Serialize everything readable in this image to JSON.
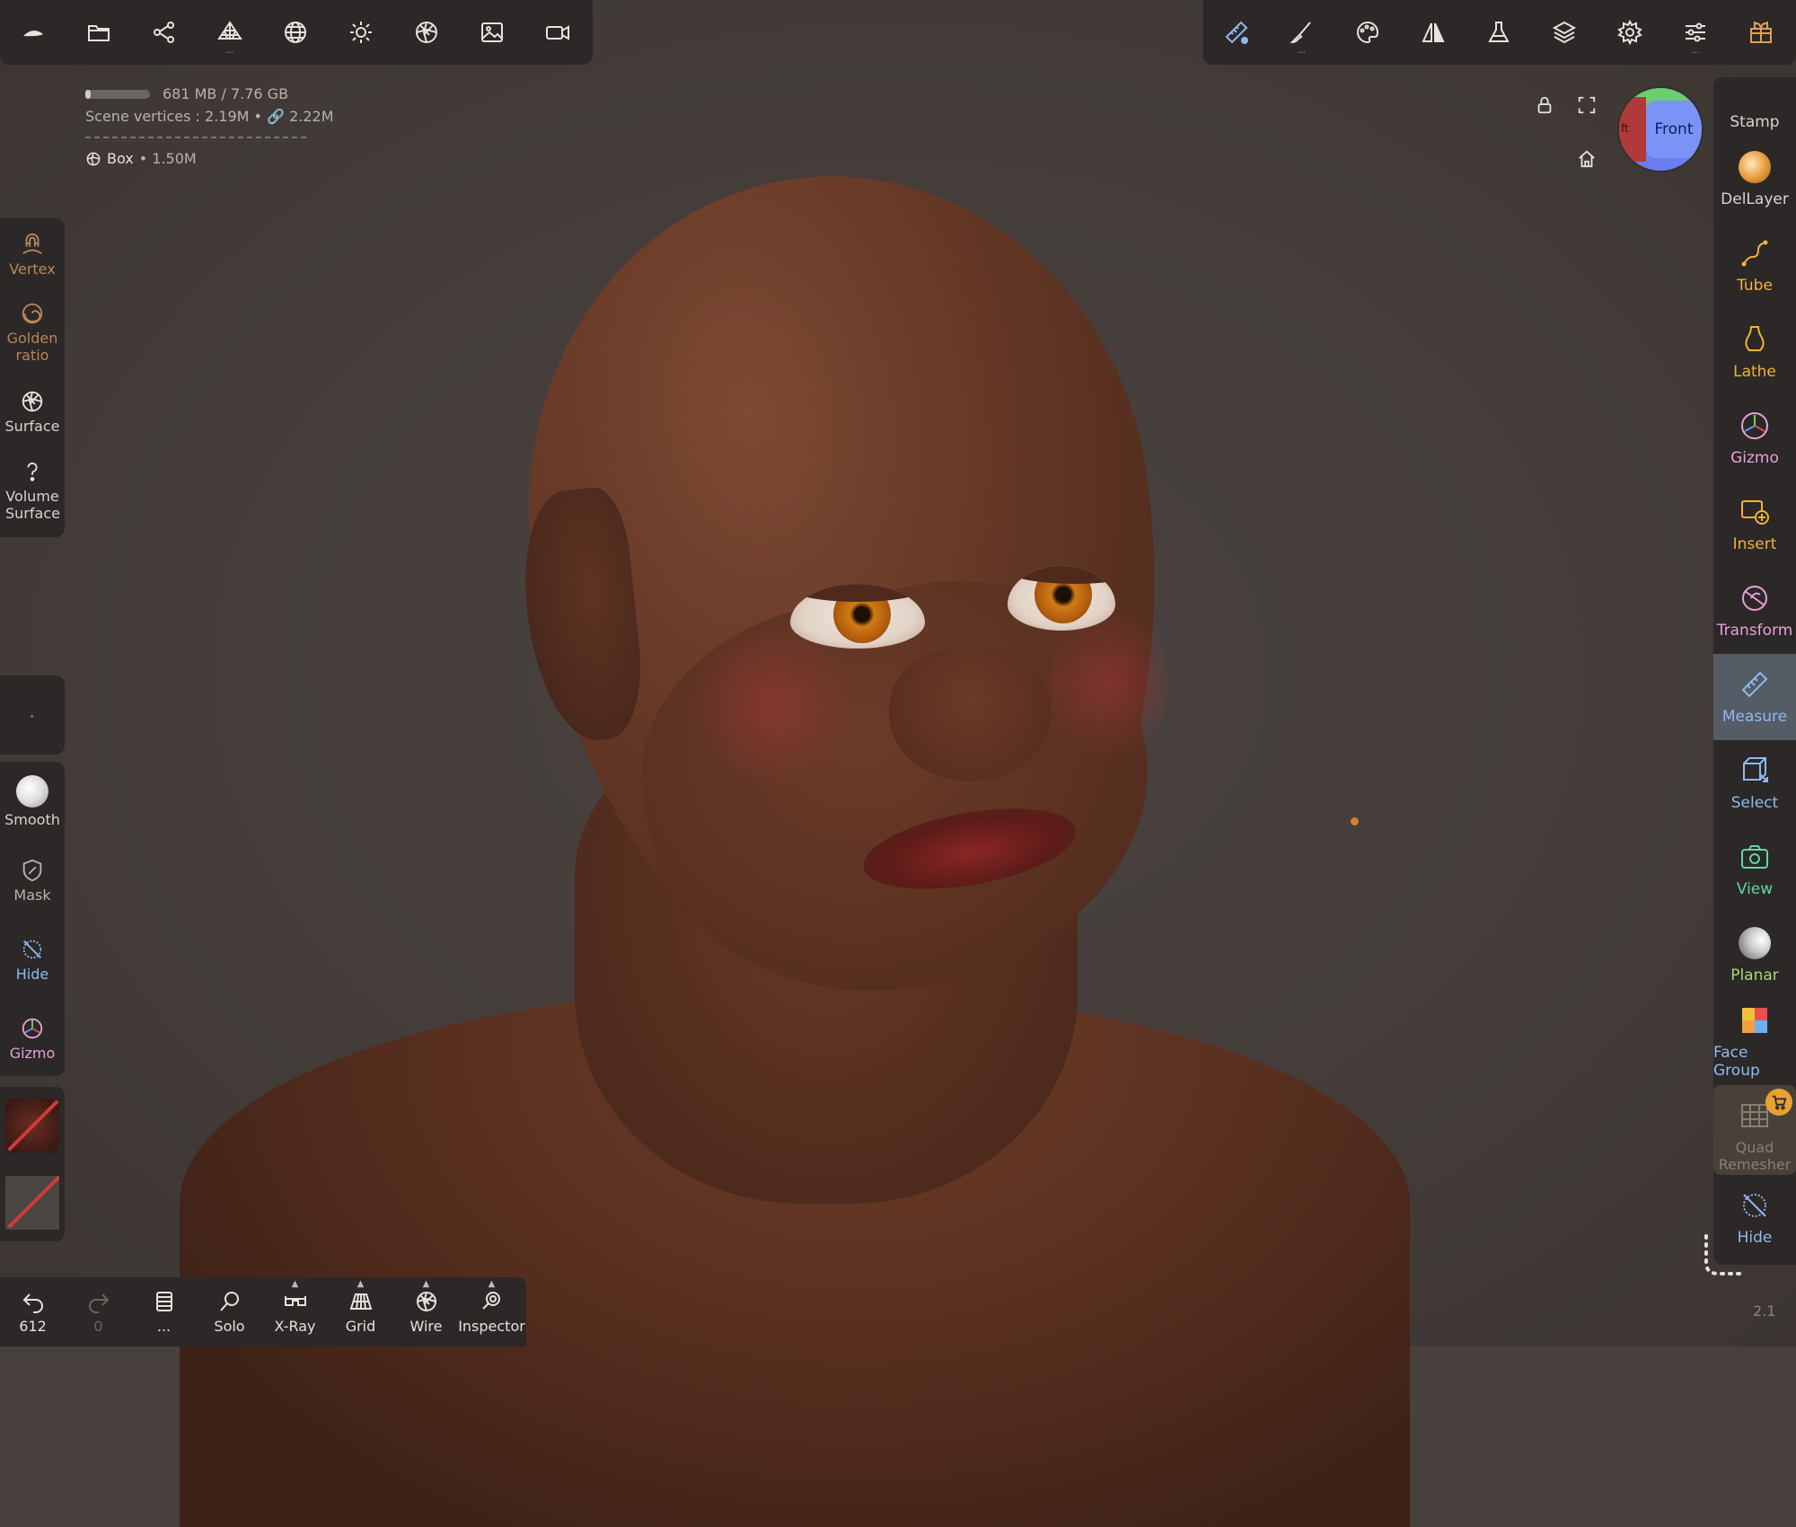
{
  "top_left_toolbar": [
    {
      "name": "nomad-logo-icon"
    },
    {
      "name": "folder-icon"
    },
    {
      "name": "scene-graph-icon"
    },
    {
      "name": "topology-icon",
      "dots": "..."
    },
    {
      "name": "mesh-sphere-icon"
    },
    {
      "name": "light-icon"
    },
    {
      "name": "shading-icon"
    },
    {
      "name": "background-image-icon"
    },
    {
      "name": "camera-icon"
    }
  ],
  "top_right_toolbar": [
    {
      "name": "measure-ruler-icon"
    },
    {
      "name": "brush-icon",
      "dots": "..."
    },
    {
      "name": "palette-icon"
    },
    {
      "name": "symmetry-icon"
    },
    {
      "name": "flask-icon"
    },
    {
      "name": "layers-icon"
    },
    {
      "name": "settings-gear-icon"
    },
    {
      "name": "sliders-icon",
      "dots": "..."
    },
    {
      "name": "gift-icon"
    }
  ],
  "info": {
    "memory": "681 MB / 7.76 GB",
    "memory_fraction": 0.09,
    "scene_vertices": "Scene vertices : 2.19M • 🔗 2.22M",
    "object_name": "Box",
    "object_vertices": "• 1.50M"
  },
  "view_cube": {
    "face": "Front",
    "side": "ft"
  },
  "left_top_tools": [
    {
      "label": "Vertex",
      "color": "#b8865a"
    },
    {
      "label": "Golden ratio",
      "color": "#b8865a"
    },
    {
      "label": "Surface",
      "color": "#e6e2de"
    },
    {
      "label": "Volume Surface",
      "color": "#e6e2de"
    }
  ],
  "left_bottom_tools": [
    {
      "label": "Smooth",
      "color": "#e6e2de"
    },
    {
      "label": "Mask",
      "color": "#b8b2ad"
    },
    {
      "label": "Hide",
      "color": "#8fb8f0"
    },
    {
      "label": "Gizmo",
      "color": "#e8a0d8"
    }
  ],
  "right_tools": [
    {
      "label": "Stamp",
      "color": "#e6e2de"
    },
    {
      "label": "DelLayer",
      "color": "#e6e2de"
    },
    {
      "label": "Tube",
      "color": "#f0b238"
    },
    {
      "label": "Lathe",
      "color": "#f0b238"
    },
    {
      "label": "Gizmo",
      "color": "#e8a0d8"
    },
    {
      "label": "Insert",
      "color": "#f0b238"
    },
    {
      "label": "Transform",
      "color": "#e8a0d8"
    },
    {
      "label": "Measure",
      "color": "#8fb8f0"
    },
    {
      "label": "Select",
      "color": "#8fb8f0"
    },
    {
      "label": "View",
      "color": "#5fd8a8"
    },
    {
      "label": "Planar",
      "color": "#a8d870"
    },
    {
      "label": "Face Group",
      "color": "#8fb8f0"
    },
    {
      "label": "Quad Remesher",
      "color": "#8a7e70"
    },
    {
      "label": "Hide",
      "color": "#8fb8f0"
    }
  ],
  "bottom_toolbar": [
    {
      "label": "612",
      "icon": "undo-icon"
    },
    {
      "label": "0",
      "icon": "redo-icon"
    },
    {
      "label": "...",
      "icon": "notebook-icon"
    },
    {
      "label": "Solo",
      "icon": "solo-search-icon"
    },
    {
      "label": "X-Ray",
      "icon": "xray-glasses-icon"
    },
    {
      "label": "Grid",
      "icon": "grid-icon"
    },
    {
      "label": "Wire",
      "icon": "wire-icon"
    },
    {
      "label": "Inspector",
      "icon": "inspector-icon"
    }
  ],
  "version": "2.1"
}
